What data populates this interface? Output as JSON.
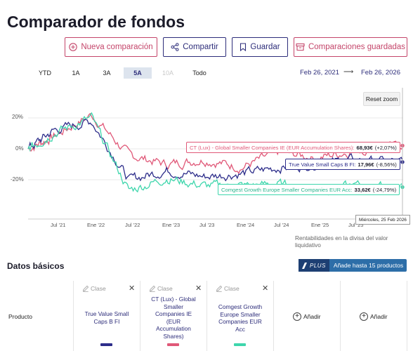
{
  "page_title": "Comparador de fondos",
  "toolbar": {
    "new": "Nueva comparación",
    "share": "Compartir",
    "save": "Guardar",
    "saved": "Comparaciones guardadas"
  },
  "ranges": [
    "YTD",
    "1A",
    "3A",
    "5A",
    "10A",
    "Todo"
  ],
  "selected_range": "5A",
  "date_from": "Feb 26, 2021",
  "date_arrow": "⟶",
  "date_to": "Feb 26, 2026",
  "reset_zoom": "Reset zoom",
  "chart_data": {
    "type": "line",
    "x": [
      "2021-02-26",
      "2021-07-01",
      "2022-01-01",
      "2022-07-01",
      "2023-01-01",
      "2023-07-01",
      "2024-01-01",
      "2024-07-01",
      "2025-01-01",
      "2025-07-01",
      "2026-02-25"
    ],
    "x_ticks": [
      "Jul '21",
      "Ene '22",
      "Jul '22",
      "Ene '23",
      "Jul '23",
      "Ene '24",
      "Jul '24",
      "Ene '25",
      "Jul '25"
    ],
    "y_ticks": [
      "20%",
      "0%",
      "-20%"
    ],
    "ylim": [
      -40,
      30
    ],
    "series": [
      {
        "name": "CT (Lux) - Global Smaller Companies IE (EUR Accumulation Shares)",
        "color": "#e05878",
        "values": [
          0,
          8,
          22,
          -4,
          -10,
          -7,
          -12,
          -2,
          -6,
          -1,
          2.07
        ]
      },
      {
        "name": "True Value Small Caps B FI",
        "color": "#2d2d8a",
        "values": [
          0,
          12,
          18,
          -20,
          -14,
          -18,
          -16,
          -12,
          -10,
          -7,
          -8.56
        ]
      },
      {
        "name": "Comgest Growth Europe Smaller Companies EUR Acc",
        "color": "#3ed6ac",
        "values": [
          0,
          10,
          20,
          -27,
          -19,
          -24,
          -24,
          -23,
          -27,
          -24,
          -24.79
        ]
      }
    ],
    "labels": [
      {
        "name": "CT (Lux) - Global Smaller Companies IE (EUR Accumulation Shares):",
        "value": "68,93€",
        "change": "(+2,07%)"
      },
      {
        "name": "True Value Small Caps B FI:",
        "value": "17,96€",
        "change": "(-8,56%)"
      },
      {
        "name": "Comgest Growth Europe Smaller Companies EUR Acc:",
        "value": "33,62€",
        "change": "(-24,79%)"
      }
    ],
    "tooltip": "Miércoles, 25 Feb 2026"
  },
  "chart_note": "Rentabilidades en la divisa del valor liquidativo",
  "basic": {
    "title": "Datos básicos",
    "plus_badge": "PLUS",
    "plus_text": "Añade hasta 15 productos",
    "row_label": "Producto",
    "clase_label": "Clase",
    "close": "✕",
    "add_label": "Añadir",
    "add_symbol": "+",
    "funds": [
      {
        "name": "True Value Small Caps B FI",
        "color": "#2d2d8a"
      },
      {
        "name": "CT (Lux) - Global Smaller Companies IE (EUR Accumulation Shares)",
        "color": "#e05878"
      },
      {
        "name": "Comgest Growth Europe Smaller Companies EUR Acc",
        "color": "#3ed6ac"
      }
    ]
  }
}
